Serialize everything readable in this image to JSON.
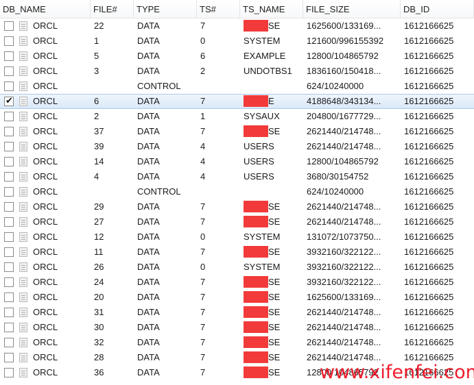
{
  "columns": [
    "DB_NAME",
    "FILE#",
    "TYPE",
    "TS#",
    "TS_NAME",
    "FILE_SIZE",
    "DB_ID"
  ],
  "colors": {
    "redaction": "#f23a3a",
    "selection": "#dbe9f8",
    "watermark": "#f01c2c"
  },
  "rows": [
    {
      "checked": false,
      "db_name": "ORCL",
      "file_no": "22",
      "type": "DATA",
      "ts_no": "7",
      "ts_name": "SE",
      "ts_redacted": true,
      "file_size": "1625600/133169...",
      "db_id": "1612166625"
    },
    {
      "checked": false,
      "db_name": "ORCL",
      "file_no": "1",
      "type": "DATA",
      "ts_no": "0",
      "ts_name": "SYSTEM",
      "ts_redacted": false,
      "file_size": "121600/996155392",
      "db_id": "1612166625"
    },
    {
      "checked": false,
      "db_name": "ORCL",
      "file_no": "5",
      "type": "DATA",
      "ts_no": "6",
      "ts_name": "EXAMPLE",
      "ts_redacted": false,
      "file_size": "12800/104865792",
      "db_id": "1612166625"
    },
    {
      "checked": false,
      "db_name": "ORCL",
      "file_no": "3",
      "type": "DATA",
      "ts_no": "2",
      "ts_name": "UNDOTBS1",
      "ts_redacted": false,
      "file_size": "1836160/150418...",
      "db_id": "1612166625"
    },
    {
      "checked": false,
      "db_name": "ORCL",
      "file_no": "",
      "type": "CONTROL",
      "ts_no": "",
      "ts_name": "",
      "ts_redacted": false,
      "file_size": "624/10240000",
      "db_id": "1612166625"
    },
    {
      "checked": true,
      "db_name": "ORCL",
      "file_no": "6",
      "type": "DATA",
      "ts_no": "7",
      "ts_name": "E",
      "ts_redacted": true,
      "file_size": "4188648/343134...",
      "db_id": "1612166625"
    },
    {
      "checked": false,
      "db_name": "ORCL",
      "file_no": "2",
      "type": "DATA",
      "ts_no": "1",
      "ts_name": "SYSAUX",
      "ts_redacted": false,
      "file_size": "204800/1677729...",
      "db_id": "1612166625"
    },
    {
      "checked": false,
      "db_name": "ORCL",
      "file_no": "37",
      "type": "DATA",
      "ts_no": "7",
      "ts_name": "SE",
      "ts_redacted": true,
      "file_size": "2621440/214748...",
      "db_id": "1612166625"
    },
    {
      "checked": false,
      "db_name": "ORCL",
      "file_no": "39",
      "type": "DATA",
      "ts_no": "4",
      "ts_name": "USERS",
      "ts_redacted": false,
      "file_size": "2621440/214748...",
      "db_id": "1612166625"
    },
    {
      "checked": false,
      "db_name": "ORCL",
      "file_no": "14",
      "type": "DATA",
      "ts_no": "4",
      "ts_name": "USERS",
      "ts_redacted": false,
      "file_size": "12800/104865792",
      "db_id": "1612166625"
    },
    {
      "checked": false,
      "db_name": "ORCL",
      "file_no": "4",
      "type": "DATA",
      "ts_no": "4",
      "ts_name": "USERS",
      "ts_redacted": false,
      "file_size": "3680/30154752",
      "db_id": "1612166625"
    },
    {
      "checked": false,
      "db_name": "ORCL",
      "file_no": "",
      "type": "CONTROL",
      "ts_no": "",
      "ts_name": "",
      "ts_redacted": false,
      "file_size": "624/10240000",
      "db_id": "1612166625"
    },
    {
      "checked": false,
      "db_name": "ORCL",
      "file_no": "29",
      "type": "DATA",
      "ts_no": "7",
      "ts_name": "SE",
      "ts_redacted": true,
      "file_size": "2621440/214748...",
      "db_id": "1612166625"
    },
    {
      "checked": false,
      "db_name": "ORCL",
      "file_no": "27",
      "type": "DATA",
      "ts_no": "7",
      "ts_name": "SE",
      "ts_redacted": true,
      "file_size": "2621440/214748...",
      "db_id": "1612166625"
    },
    {
      "checked": false,
      "db_name": "ORCL",
      "file_no": "12",
      "type": "DATA",
      "ts_no": "0",
      "ts_name": "SYSTEM",
      "ts_redacted": false,
      "file_size": "131072/1073750...",
      "db_id": "1612166625"
    },
    {
      "checked": false,
      "db_name": "ORCL",
      "file_no": "11",
      "type": "DATA",
      "ts_no": "7",
      "ts_name": "SE",
      "ts_redacted": true,
      "file_size": "3932160/322122...",
      "db_id": "1612166625"
    },
    {
      "checked": false,
      "db_name": "ORCL",
      "file_no": "26",
      "type": "DATA",
      "ts_no": "0",
      "ts_name": "SYSTEM",
      "ts_redacted": false,
      "file_size": "3932160/322122...",
      "db_id": "1612166625"
    },
    {
      "checked": false,
      "db_name": "ORCL",
      "file_no": "24",
      "type": "DATA",
      "ts_no": "7",
      "ts_name": "SE",
      "ts_redacted": true,
      "file_size": "3932160/322122...",
      "db_id": "1612166625"
    },
    {
      "checked": false,
      "db_name": "ORCL",
      "file_no": "20",
      "type": "DATA",
      "ts_no": "7",
      "ts_name": "SE",
      "ts_redacted": true,
      "file_size": "1625600/133169...",
      "db_id": "1612166625"
    },
    {
      "checked": false,
      "db_name": "ORCL",
      "file_no": "31",
      "type": "DATA",
      "ts_no": "7",
      "ts_name": "SE",
      "ts_redacted": true,
      "file_size": "2621440/214748...",
      "db_id": "1612166625"
    },
    {
      "checked": false,
      "db_name": "ORCL",
      "file_no": "30",
      "type": "DATA",
      "ts_no": "7",
      "ts_name": "SE",
      "ts_redacted": true,
      "file_size": "2621440/214748...",
      "db_id": "1612166625"
    },
    {
      "checked": false,
      "db_name": "ORCL",
      "file_no": "32",
      "type": "DATA",
      "ts_no": "7",
      "ts_name": "SE",
      "ts_redacted": true,
      "file_size": "2621440/214748...",
      "db_id": "1612166625"
    },
    {
      "checked": false,
      "db_name": "ORCL",
      "file_no": "28",
      "type": "DATA",
      "ts_no": "7",
      "ts_name": "SE",
      "ts_redacted": true,
      "file_size": "2621440/214748...",
      "db_id": "1612166625"
    },
    {
      "checked": false,
      "db_name": "ORCL",
      "file_no": "36",
      "type": "DATA",
      "ts_no": "7",
      "ts_name": "SE",
      "ts_redacted": true,
      "file_size": "12800/104865792",
      "db_id": "1612166625"
    }
  ],
  "watermark": "www.xifenfei.com"
}
